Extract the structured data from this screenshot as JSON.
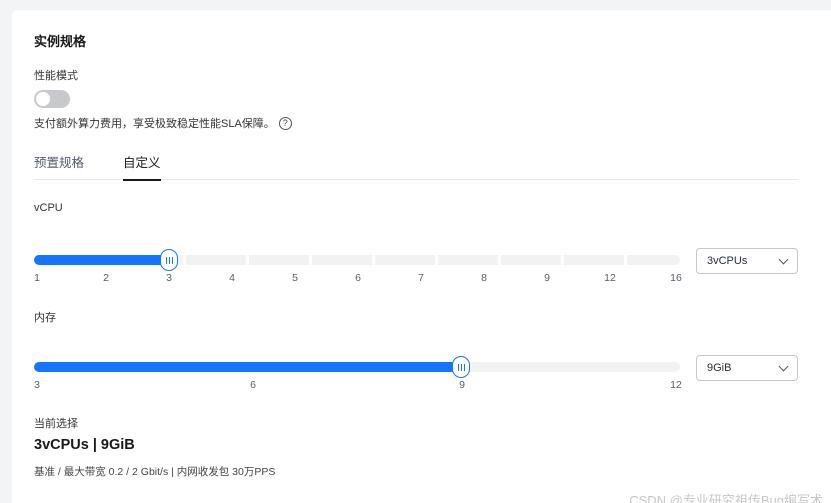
{
  "section_title": "实例规格",
  "performance_mode": {
    "label": "性能模式",
    "enabled": false,
    "description": "支付额外算力费用，享受极致稳定性能SLA保障。",
    "help_icon": "question-circle-icon"
  },
  "tabs": [
    {
      "label": "预置规格",
      "active": false
    },
    {
      "label": "自定义",
      "active": true
    }
  ],
  "vcpu": {
    "label": "vCPU",
    "ticks": [
      "1",
      "2",
      "3",
      "4",
      "5",
      "6",
      "7",
      "8",
      "9",
      "12",
      "16"
    ],
    "selected_index": 2,
    "select_value": "3vCPUs"
  },
  "memory": {
    "label": "内存",
    "ticks": [
      "3",
      "6",
      "9",
      "12"
    ],
    "selected_index": 2,
    "select_value": "9GiB"
  },
  "current": {
    "label": "当前选择",
    "value": "3vCPUs | 9GiB",
    "detail": "基准 / 最大带宽  0.2 / 2 Gbit/s  |  内网收发包  30万PPS"
  },
  "watermark": "CSDN @专业研究祖传Bug编写术",
  "colors": {
    "accent": "#1476ff",
    "track": "#f2f2f2",
    "toggle_off": "#c7c9cc"
  }
}
